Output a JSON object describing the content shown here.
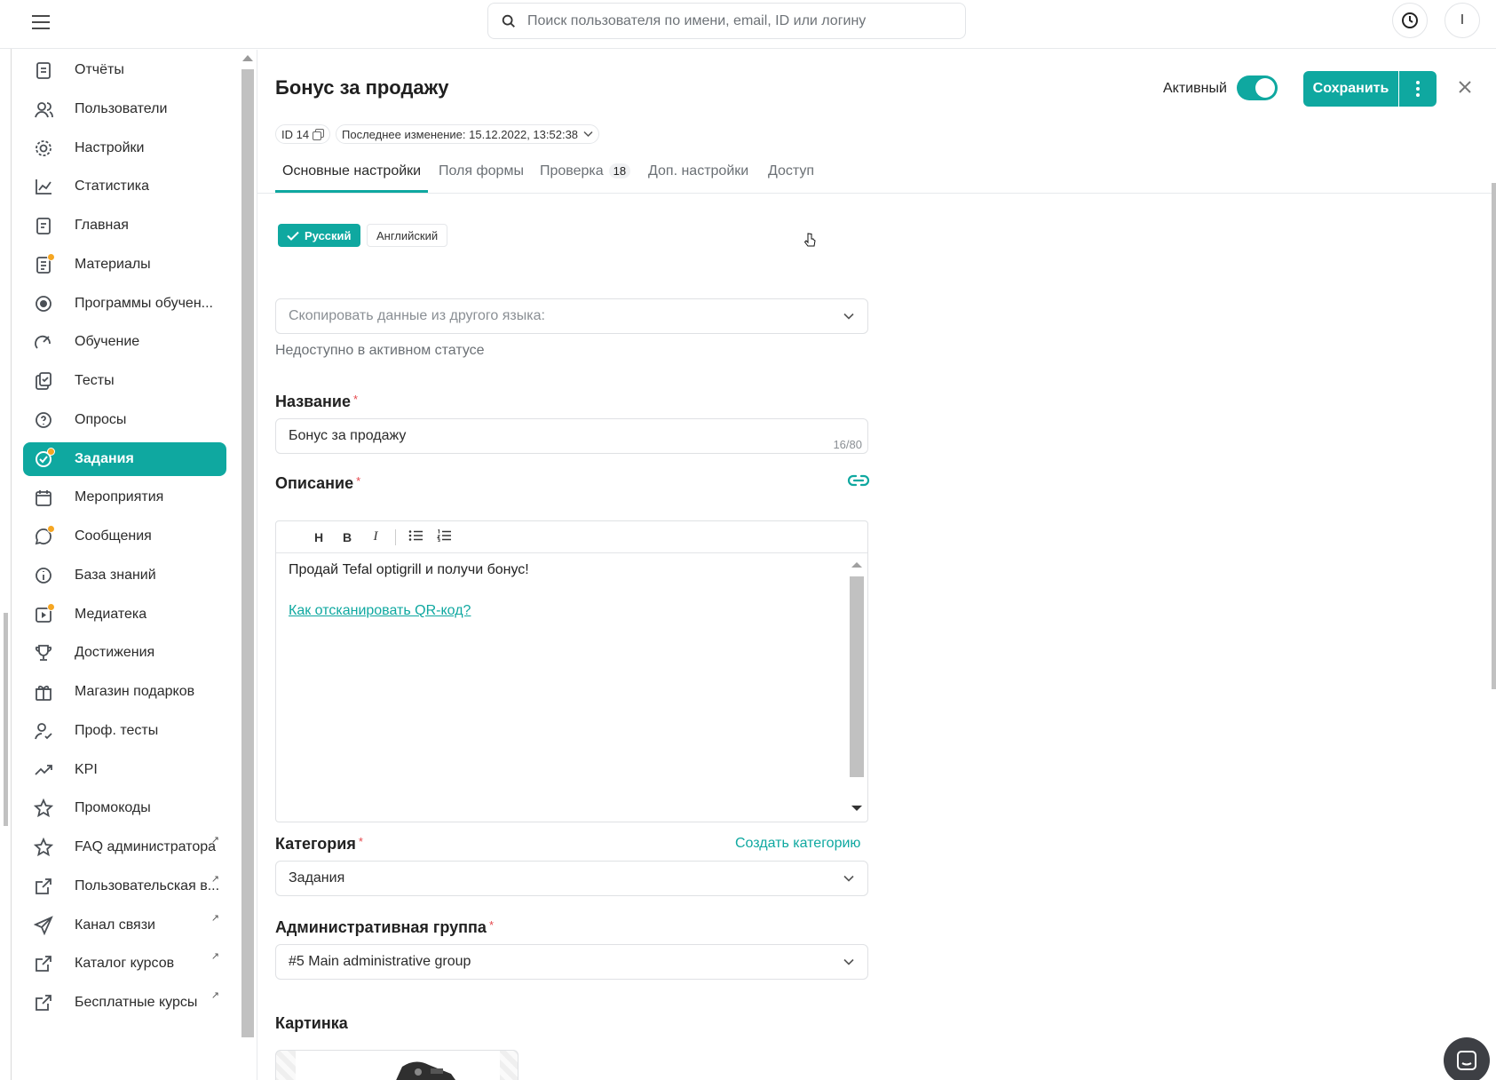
{
  "search": {
    "placeholder": "Поиск пользователя по имени, email, ID или логину"
  },
  "header": {
    "avatar_initial": "I"
  },
  "sidebar": {
    "items": [
      {
        "label": "Отчёты",
        "icon": "reports-icon"
      },
      {
        "label": "Пользователи",
        "icon": "users-icon"
      },
      {
        "label": "Настройки",
        "icon": "gear-icon"
      },
      {
        "label": "Статистика",
        "icon": "chart-line-icon"
      },
      {
        "label": "Главная",
        "icon": "home-icon"
      },
      {
        "label": "Материалы",
        "icon": "materials-icon",
        "dot": true
      },
      {
        "label": "Программы обучен...",
        "icon": "programs-icon"
      },
      {
        "label": "Обучение",
        "icon": "learning-icon"
      },
      {
        "label": "Тесты",
        "icon": "tests-icon"
      },
      {
        "label": "Опросы",
        "icon": "surveys-icon"
      },
      {
        "label": "Задания",
        "icon": "tasks-icon",
        "active": true,
        "dot": true
      },
      {
        "label": "Мероприятия",
        "icon": "calendar-icon"
      },
      {
        "label": "Сообщения",
        "icon": "messages-icon",
        "dot": true
      },
      {
        "label": "База знаний",
        "icon": "info-icon"
      },
      {
        "label": "Медиатека",
        "icon": "media-icon",
        "dot": true
      },
      {
        "label": "Достижения",
        "icon": "trophy-icon"
      },
      {
        "label": "Магазин подарков",
        "icon": "gift-icon"
      },
      {
        "label": "Проф. тесты",
        "icon": "user-check-icon"
      },
      {
        "label": "KPI",
        "icon": "trend-icon"
      },
      {
        "label": "Промокоды",
        "icon": "star-icon"
      },
      {
        "label": "FAQ администратора",
        "icon": "star-icon",
        "external": true
      },
      {
        "label": "Пользовательская в...",
        "icon": "external-link-icon",
        "external": true
      },
      {
        "label": "Канал связи",
        "icon": "send-icon",
        "external": true
      },
      {
        "label": "Каталог курсов",
        "icon": "external-link-icon",
        "external": true
      },
      {
        "label": "Бесплатные курсы",
        "icon": "external-link-icon",
        "external": true
      }
    ]
  },
  "page": {
    "title": "Бонус за продажу",
    "active_label": "Активный",
    "active": true,
    "save_label": "Сохранить",
    "id_label": "ID 14",
    "last_change": "Последнее изменение: 15.12.2022, 13:52:38"
  },
  "tabs": [
    {
      "label": "Основные настройки",
      "active": true
    },
    {
      "label": "Поля формы"
    },
    {
      "label": "Проверка",
      "badge": "18"
    },
    {
      "label": "Доп. настройки"
    },
    {
      "label": "Доступ"
    }
  ],
  "languages": {
    "selected": "Русский",
    "other": "Английский"
  },
  "copy_lang": {
    "placeholder": "Скопировать данные из другого языка:",
    "hint": "Недоступно в активном статусе"
  },
  "fields": {
    "name_label": "Название",
    "name_value": "Бонус за продажу",
    "name_counter": "16/80",
    "description_label": "Описание",
    "description_text": "Продай Tefal optigrill и получи бонус!",
    "description_link": "Как отсканировать QR-код?",
    "toolbar": {
      "h": "H",
      "b": "B",
      "i": "I"
    },
    "category_label": "Категория",
    "create_category": "Создать категорию",
    "category_value": "Задания",
    "admin_group_label": "Административная группа",
    "admin_group_value": "#5 Main administrative group",
    "image_label": "Картинка"
  },
  "required_mark": "*",
  "colors": {
    "accent": "#0fa8a0",
    "required": "#e5484d",
    "dot": "#f5a623"
  }
}
